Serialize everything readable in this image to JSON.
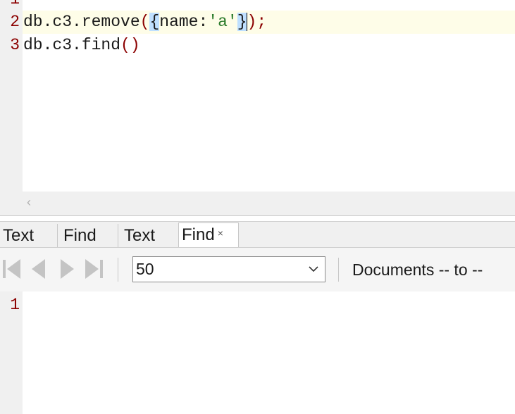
{
  "editor": {
    "line_numbers": [
      "1",
      "2",
      "3"
    ],
    "line2": {
      "obj": "db.c3.remove",
      "open_paren": "(",
      "open_brace": "{",
      "key": "name:",
      "value": "'a'",
      "close_brace": "}",
      "close_paren": ")",
      "semicolon": ";"
    },
    "line3": {
      "obj": "db.c3.find",
      "parens": "()"
    }
  },
  "scrollbar": {
    "left_arrow": "‹"
  },
  "tabs": [
    {
      "label": "Text"
    },
    {
      "label": "Find"
    },
    {
      "label": "Text"
    },
    {
      "label": "Find",
      "close": "×"
    }
  ],
  "toolbar": {
    "nav_icons": [
      "first-page-icon",
      "previous-page-icon",
      "next-page-icon",
      "last-page-icon"
    ],
    "page_size": "50",
    "documents_label": "Documents -- to --"
  },
  "result": {
    "line_numbers": [
      "1"
    ]
  },
  "colors": {
    "line_number": "#8b0000",
    "current_line_bg": "#fefde8",
    "brace_highlight": "#bfe0ff",
    "string": "#2a7a2a"
  }
}
